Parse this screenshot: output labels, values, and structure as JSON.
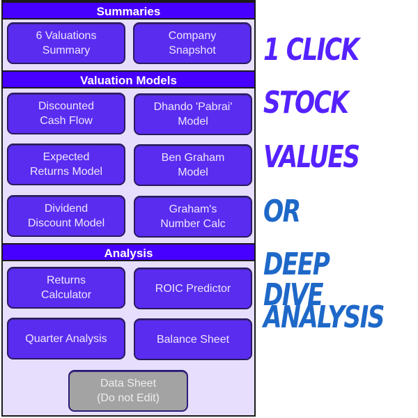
{
  "sections": {
    "summaries": {
      "title": "Summaries",
      "buttons": [
        "6 Valuations\nSummary",
        "Company\nSnapshot"
      ]
    },
    "valuation_models": {
      "title": "Valuation Models",
      "buttons": [
        "Discounted\nCash Flow",
        "Dhando 'Pabrai'\nModel",
        "Expected\nReturns Model",
        "Ben Graham\nModel",
        "Dividend\nDiscount Model",
        "Graham's\nNumber Calc"
      ]
    },
    "analysis": {
      "title": "Analysis",
      "buttons": [
        "Returns\nCalculator",
        "ROIC Predictor",
        "Quarter Analysis",
        "Balance Sheet"
      ],
      "data_sheet": "Data Sheet\n(Do not Edit)"
    }
  },
  "promo": {
    "lines": [
      "1 CLICK",
      "STOCK",
      "VALUES",
      "OR",
      "DEEP DIVE",
      "ANALYSIS"
    ],
    "colors": {
      "primary": "#5522ff",
      "secondary": "#1e68c8"
    }
  },
  "colors": {
    "header": "#4700ff",
    "button": "#5a2cf0",
    "panel": "#e6defc",
    "disabled": "#a3a3a3"
  }
}
